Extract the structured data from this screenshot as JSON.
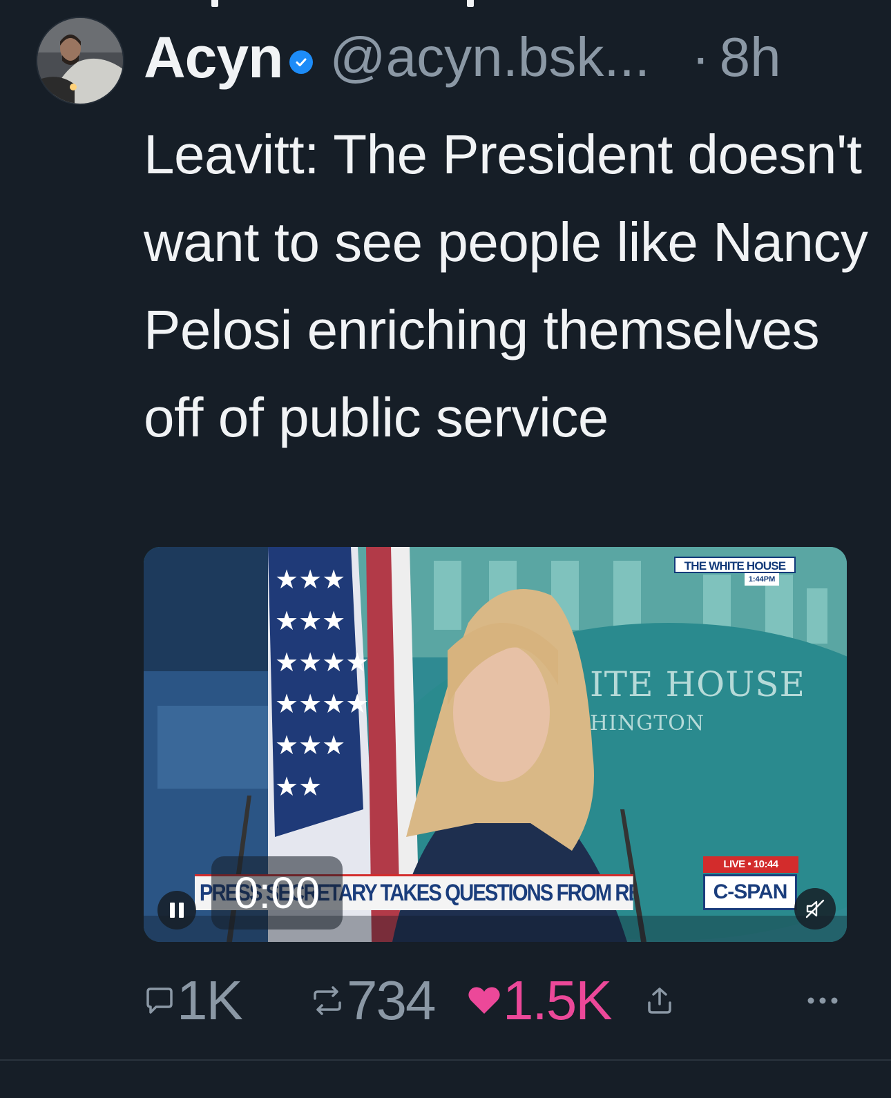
{
  "post": {
    "author": {
      "display_name": "Acyn",
      "handle": "@acyn.bsk...",
      "verified": true
    },
    "separator": "·",
    "timestamp": "8h",
    "text": "Leavitt: The President doesn't want to see people like Nancy Pelosi enriching themselves off of public service",
    "video": {
      "current_time": "0:00",
      "overlay": {
        "network_badge": "THE WHITE HOUSE",
        "network_time": "1:44PM",
        "wall_text_line1": "ITE HOUSE",
        "wall_text_line2": "HINGTON",
        "live_label": "LIVE • 10:44",
        "lower_third": "PRESS SECRETARY TAKES QUESTIONS FROM REPORTERS",
        "network_logo": "C-SPAN"
      },
      "state": "playing",
      "muted": true
    },
    "actions": {
      "replies": "1K",
      "reposts": "734",
      "likes": "1.5K",
      "liked": true
    }
  },
  "colors": {
    "background": "#161e27",
    "text_primary": "#f1f3f5",
    "text_secondary": "#8b98a5",
    "verified": "#1d8cf8",
    "like": "#ec4899"
  },
  "icons": [
    "verified-badge-icon",
    "pause-icon",
    "mute-icon",
    "reply-icon",
    "repost-icon",
    "heart-icon",
    "share-icon",
    "more-icon"
  ]
}
